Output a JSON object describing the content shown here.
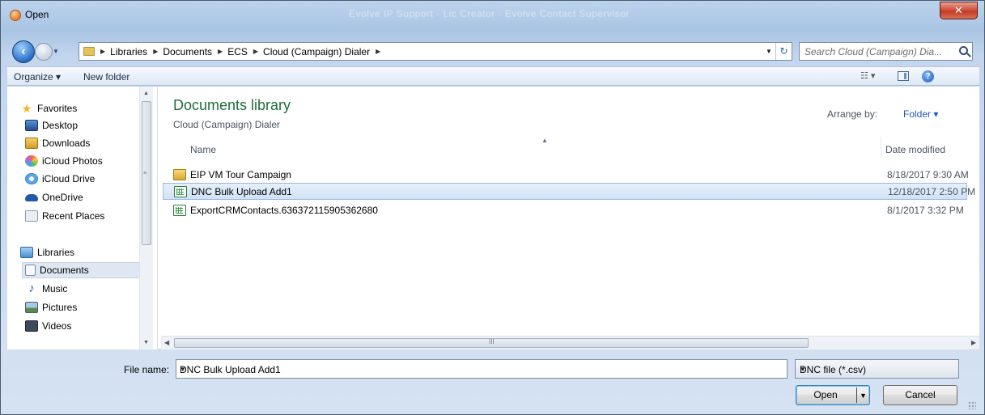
{
  "window": {
    "title": "Open",
    "ghost_title": "Evolve IP  Support  ·  Lic Creator  ·  Evolve Contact  Supervisor"
  },
  "address": {
    "crumbs": [
      "Libraries",
      "Documents",
      "ECS",
      "Cloud (Campaign) Dialer"
    ]
  },
  "search": {
    "placeholder": "Search Cloud (Campaign) Dia..."
  },
  "toolbar": {
    "organize": "Organize ▾",
    "new_folder": "New folder"
  },
  "nav": {
    "favorites": [
      "Favorites",
      "Desktop",
      "Downloads",
      "iCloud Photos",
      "iCloud Drive",
      "OneDrive",
      "Recent Places"
    ],
    "libraries": [
      "Libraries",
      "Documents",
      "Music",
      "Pictures",
      "Videos"
    ],
    "selected": "Documents"
  },
  "library": {
    "title": "Documents library",
    "subtitle": "Cloud (Campaign) Dialer",
    "arrange_label": "Arrange by:",
    "arrange_value": "Folder ▾"
  },
  "columns": {
    "name": "Name",
    "date": "Date modified"
  },
  "files": [
    {
      "name": "EIP VM Tour Campaign",
      "date": "8/18/2017 9:30 AM",
      "type": "folder"
    },
    {
      "name": "DNC Bulk Upload Add1",
      "date": "12/18/2017 2:50 PM",
      "type": "csv"
    },
    {
      "name": "ExportCRMContacts.636372115905362680",
      "date": "8/1/2017 3:32 PM",
      "type": "csv"
    }
  ],
  "bottom": {
    "filename_label": "File name:",
    "filename_value": "DNC Bulk Upload Add1",
    "filetype": "DNC file (*.csv)",
    "open_label": "Open",
    "cancel_label": "Cancel"
  },
  "colors": {
    "library_title": "#1e6e3a",
    "link_blue": "#1e5cb6",
    "selection": "#d0e2f5"
  }
}
